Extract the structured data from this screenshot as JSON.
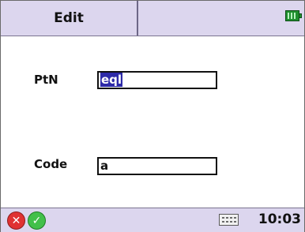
{
  "header": {
    "title": "Edit"
  },
  "form": {
    "ptn_label": "PtN",
    "ptn_value": "eql",
    "code_label": "Code",
    "code_value": "a"
  },
  "footer": {
    "time": "10:03"
  },
  "icons": {
    "battery": "battery-icon",
    "cancel": "cancel-icon",
    "ok": "ok-icon",
    "keyboard": "keyboard-icon"
  },
  "colors": {
    "bar_bg": "#dcd6ee",
    "selection": "#2d2aa8",
    "cancel": "#e03232",
    "ok": "#42c04a",
    "battery": "#1f8f2e"
  }
}
